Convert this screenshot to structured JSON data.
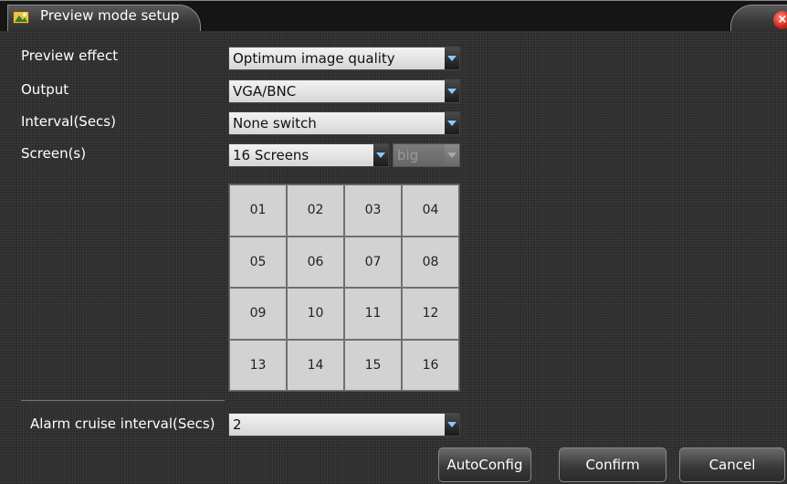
{
  "window": {
    "title": "Preview mode setup",
    "close_glyph": "×",
    "icon": "settings-image-icon"
  },
  "rows": {
    "preview_effect": {
      "label": "Preview effect",
      "value": "Optimum image quality"
    },
    "output": {
      "label": "Output",
      "value": "VGA/BNC"
    },
    "interval": {
      "label": "Interval(Secs)",
      "value": "None switch"
    },
    "screens": {
      "label": "Screen(s)",
      "value": "16 Screens",
      "size_value": "big"
    }
  },
  "grid": {
    "cells": [
      "01",
      "02",
      "03",
      "04",
      "05",
      "06",
      "07",
      "08",
      "09",
      "10",
      "11",
      "12",
      "13",
      "14",
      "15",
      "16"
    ]
  },
  "alarm": {
    "label": "Alarm cruise interval(Secs)",
    "value": "2"
  },
  "buttons": {
    "autoconfig": "AutoConfig",
    "confirm": "Confirm",
    "cancel": "Cancel"
  },
  "colors": {
    "accent_arrow": "#8cc8ff",
    "close": "#d0241a"
  }
}
